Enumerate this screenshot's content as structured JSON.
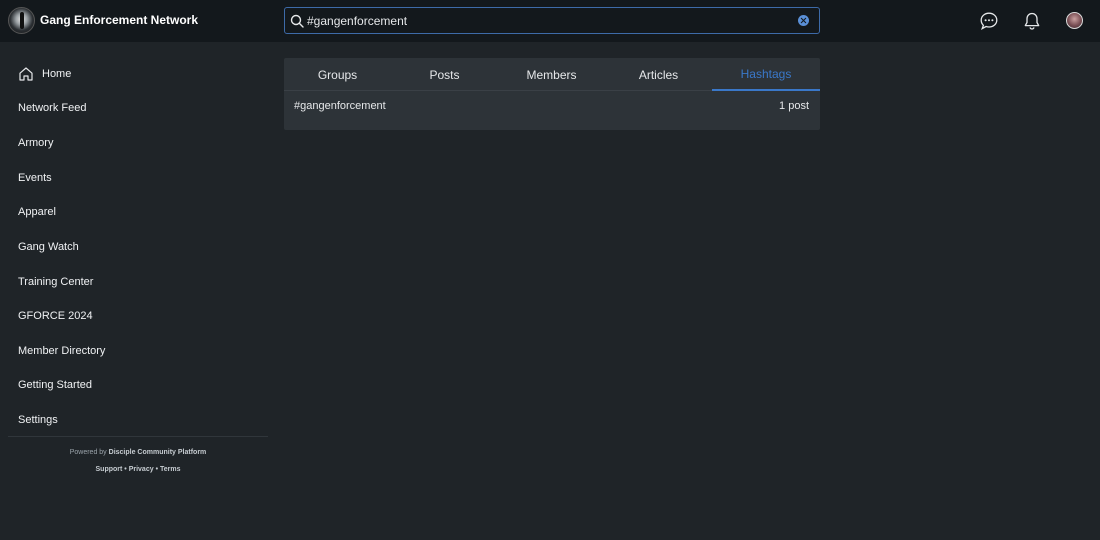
{
  "header": {
    "brand": "Gang Enforcement Network",
    "search_value": "#gangenforcement"
  },
  "sidebar": {
    "items": [
      {
        "label": "Home",
        "icon": "home-icon"
      },
      {
        "label": "Network Feed"
      },
      {
        "label": "Armory"
      },
      {
        "label": "Events"
      },
      {
        "label": "Apparel"
      },
      {
        "label": "Gang Watch"
      },
      {
        "label": "Training Center"
      },
      {
        "label": "GFORCE 2024"
      },
      {
        "label": "Member Directory"
      },
      {
        "label": "Getting Started"
      },
      {
        "label": "Settings"
      }
    ],
    "powered_prefix": "Powered by",
    "powered_name": "Disciple Community Platform",
    "footer": {
      "support": "Support",
      "sep": "•",
      "privacy": "Privacy",
      "terms": "Terms"
    }
  },
  "results": {
    "tabs": [
      "Groups",
      "Posts",
      "Members",
      "Articles",
      "Hashtags"
    ],
    "active_tab": "Hashtags",
    "rows": [
      {
        "tag": "#gangenforcement",
        "count": "1 post"
      }
    ]
  },
  "colors": {
    "accent": "#3a78c9",
    "background": "#1f2428",
    "topbar": "#13181c",
    "panel": "#2d3338"
  }
}
